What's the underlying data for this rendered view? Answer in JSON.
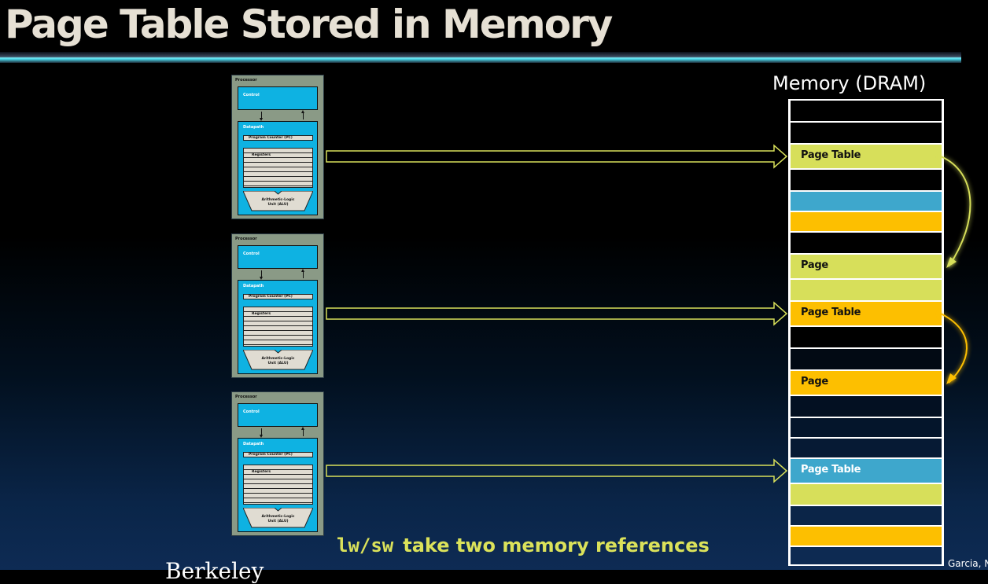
{
  "title": "Page Table Stored in Memory",
  "memory": {
    "title": "Memory (DRAM)",
    "rows": [
      {
        "label": "",
        "color": "#000000"
      },
      {
        "label": "",
        "color": "#000000"
      },
      {
        "label": "Page Table",
        "color": "#d7df5a",
        "text_color": "#111111"
      },
      {
        "label": "",
        "color": "#000000"
      },
      {
        "label": "",
        "color": "#3ea7cc"
      },
      {
        "label": "",
        "color": "#fdbf00"
      },
      {
        "label": "",
        "color": "#000000"
      },
      {
        "label": "Page",
        "color": "#d7df5a",
        "text_color": "#111111"
      },
      {
        "label": "",
        "color": "#d7df5a"
      },
      {
        "label": "Page Table",
        "color": "#fdbf00",
        "text_color": "#111111"
      },
      {
        "label": "",
        "color": "#000000"
      },
      {
        "label": "",
        "color": "#020a14"
      },
      {
        "label": "Page",
        "color": "#fdbf00",
        "text_color": "#111111"
      },
      {
        "label": "",
        "color": "#031022"
      },
      {
        "label": "",
        "color": "#04152b"
      },
      {
        "label": "",
        "color": "#061a34"
      },
      {
        "label": "Page Table",
        "color": "#3ea7cc",
        "text_color": "#ffffff"
      },
      {
        "label": "",
        "color": "#d7df5a"
      },
      {
        "label": "",
        "color": "#0b2548"
      },
      {
        "label": "",
        "color": "#fdbf00"
      },
      {
        "label": "",
        "color": "#0d2a52"
      }
    ]
  },
  "processors": [
    {
      "label": "Processor",
      "control": "Control",
      "datapath": "Datapath",
      "pc": "Program Counter (PC)",
      "registers": "Registers",
      "alu_line1": "Arithmetic-Logic",
      "alu_line2": "Unit (ALU)"
    },
    {
      "label": "Processor",
      "control": "Control",
      "datapath": "Datapath",
      "pc": "Program Counter (PC)",
      "registers": "Registers",
      "alu_line1": "Arithmetic-Logic",
      "alu_line2": "Unit (ALU)"
    },
    {
      "label": "Processor",
      "control": "Control",
      "datapath": "Datapath",
      "pc": "Program Counter (PC)",
      "registers": "Registers",
      "alu_line1": "Arithmetic-Logic",
      "alu_line2": "Unit (ALU)"
    }
  ],
  "arrows": [
    {
      "from": "processor-1",
      "to": "Page Table (lime)",
      "color": "#d7df5a"
    },
    {
      "from": "processor-2",
      "to": "Page Table (orange)",
      "color": "#d7df5a"
    },
    {
      "from": "processor-3",
      "to": "Page Table (blue)",
      "color": "#d7df5a"
    }
  ],
  "curved_arrows": [
    {
      "from": "Page Table (lime)",
      "to": "Page (lime)",
      "color": "#d7df5a"
    },
    {
      "from": "Page Table (orange)",
      "to": "Page (orange)",
      "color": "#fdbf00"
    }
  ],
  "bottom": {
    "code": "lw/sw",
    "text": "take two memory references"
  },
  "footer": {
    "left": "Berkeley",
    "credit": "Garcia, Nikolić"
  },
  "colors": {
    "lime": "#d7df5a",
    "orange": "#fdbf00",
    "blue": "#3ea7cc",
    "processor_cyan": "#0eb2e2",
    "title": "#e6e0d4"
  }
}
